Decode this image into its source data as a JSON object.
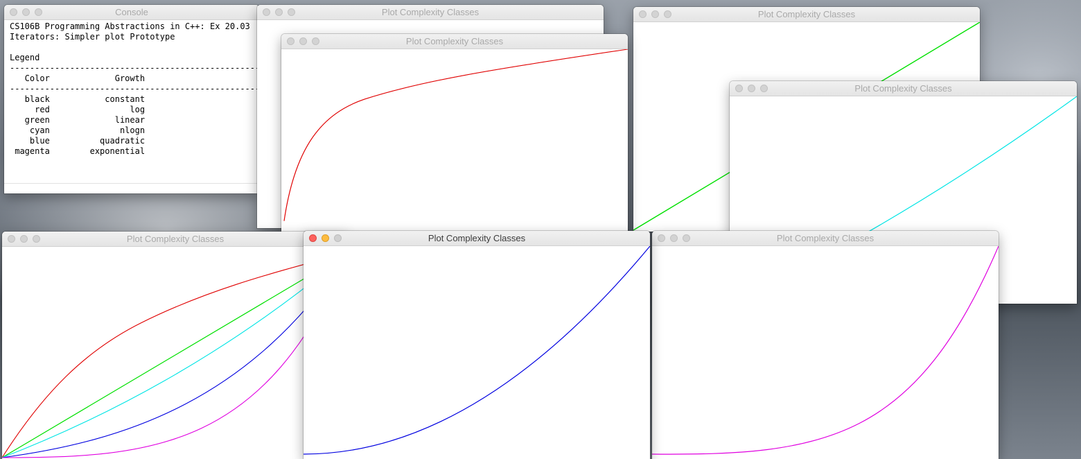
{
  "console": {
    "title": "Console",
    "lines": [
      "CS106B Programming Abstractions in C++: Ex 20.03",
      "Iterators: Simpler plot Prototype",
      "",
      "Legend",
      "--------------------------------------------------",
      "   Color             Growth",
      "--------------------------------------------------",
      "   black           constant",
      "     red                log",
      "   green             linear",
      "    cyan              nlogn",
      "    blue          quadratic",
      " magenta        exponential"
    ]
  },
  "legend": [
    {
      "color_name": "black",
      "growth": "constant",
      "hex": "#000000"
    },
    {
      "color_name": "red",
      "growth": "log",
      "hex": "#e00000"
    },
    {
      "color_name": "green",
      "growth": "linear",
      "hex": "#00e000"
    },
    {
      "color_name": "cyan",
      "growth": "nlogn",
      "hex": "#00e5e5"
    },
    {
      "color_name": "blue",
      "growth": "quadratic",
      "hex": "#0000e0"
    },
    {
      "color_name": "magenta",
      "growth": "exponential",
      "hex": "#e000e0"
    }
  ],
  "plot_window_title": "Plot Complexity Classes",
  "chart_data": [
    {
      "type": "line",
      "window": "log-window",
      "series": [
        {
          "growth": "log",
          "color": "#e00000"
        }
      ]
    },
    {
      "type": "line",
      "window": "linear-window",
      "series": [
        {
          "growth": "linear",
          "color": "#00e000"
        }
      ]
    },
    {
      "type": "line",
      "window": "nlogn-window",
      "series": [
        {
          "growth": "nlogn",
          "color": "#00e5e5"
        }
      ]
    },
    {
      "type": "line",
      "window": "all-classes-window",
      "series": [
        {
          "growth": "log",
          "color": "#e00000"
        },
        {
          "growth": "linear",
          "color": "#00e000"
        },
        {
          "growth": "nlogn",
          "color": "#00e5e5"
        },
        {
          "growth": "quadratic",
          "color": "#0000e0"
        },
        {
          "growth": "exponential",
          "color": "#e000e0"
        }
      ]
    },
    {
      "type": "line",
      "window": "quadratic-window",
      "series": [
        {
          "growth": "quadratic",
          "color": "#0000e0"
        }
      ]
    },
    {
      "type": "line",
      "window": "exponential-window",
      "series": [
        {
          "growth": "exponential",
          "color": "#e000e0"
        }
      ]
    }
  ]
}
